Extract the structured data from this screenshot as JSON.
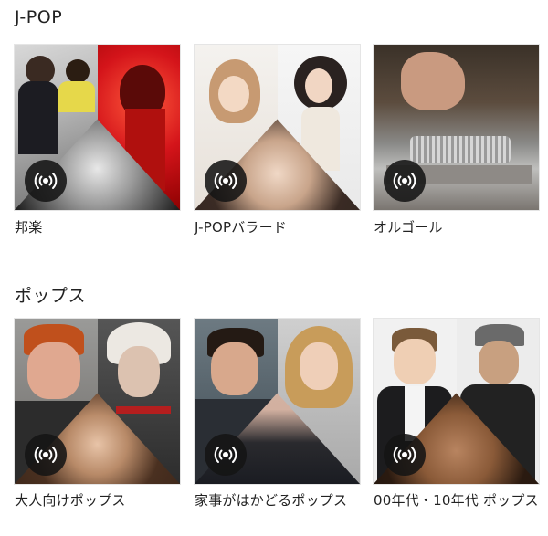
{
  "sections": [
    {
      "title": "J-POP",
      "items": [
        {
          "label": "邦楽"
        },
        {
          "label": "J-POPバラード"
        },
        {
          "label": "オルゴール"
        }
      ]
    },
    {
      "title": "ポップス",
      "items": [
        {
          "label": "大人向けポップス"
        },
        {
          "label": "家事がはかどるポップス"
        },
        {
          "label": "00年代・10年代 ポップス"
        }
      ]
    }
  ],
  "icons": {
    "play": "radio-broadcast-icon"
  },
  "colors": {
    "overlay": "#141414",
    "text": "#222222",
    "background": "#ffffff"
  }
}
